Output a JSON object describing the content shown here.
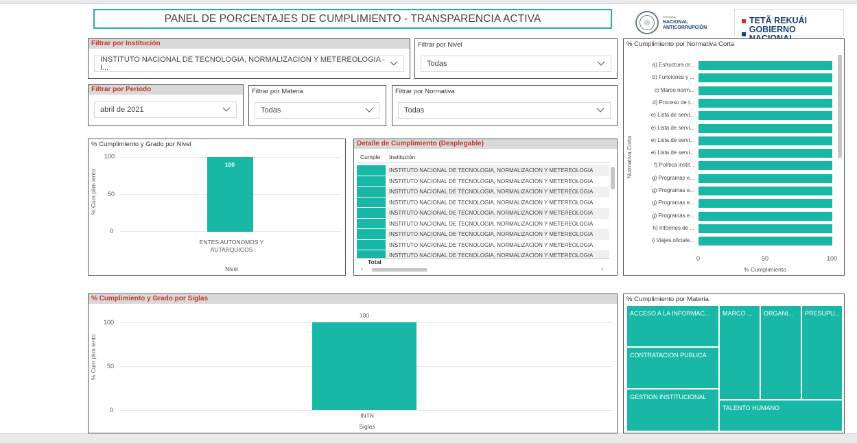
{
  "header": {
    "title": "PANEL DE PORCENTAJES DE CUMPLIMIENTO - TRANSPARENCIA ACTIVA",
    "logo_secretaria_small": "Secretaría",
    "logo_secretaria_line1": "NACIONAL",
    "logo_secretaria_line2": "ANTICORRUPCIÓN",
    "logo_gobierno_line1": "TETÃ REKUÁI",
    "logo_gobierno_line2": "GOBIERNO NACIONAL"
  },
  "filters": {
    "institucion": {
      "label": "Filtrar por Institución",
      "value": "INSTITUTO NACIONAL DE TECNOLOGIA, NORMALIZACION Y METEREOLOGIA - I..."
    },
    "nivel": {
      "label": "Filtrar por Nivel",
      "value": "Todas"
    },
    "periodo": {
      "label": "Filtrar por Periodo",
      "value": "abril de 2021"
    },
    "materia": {
      "label": "Filtrar por Materia",
      "value": "Todas"
    },
    "normativa": {
      "label": "Filtrar por Normativa",
      "value": "Todas"
    }
  },
  "chart_nivel": {
    "title": "% Cumplimiento y Grado por Nivel",
    "ylabel": "% Cum plim iento",
    "xlabel": "Nivel",
    "yticks": [
      "100",
      "50",
      "0"
    ],
    "data_label": "100"
  },
  "table": {
    "title": "Detalle de Cumplimiento (Desplegable)",
    "col1": "Cumple",
    "col2": "Institución",
    "row_text": "INSTITUTO NACIONAL DE TECNOLOGIA, NORMALIZACION Y METEREOLOGIA",
    "total_label": "Total"
  },
  "chart_normativa": {
    "title": "% Cumplimiento por Normativa Corta",
    "ylabel": "Normativa Corta",
    "xlabel": "% Cumplimiento",
    "xticks": [
      "0",
      "50",
      "100"
    ]
  },
  "chart_siglas": {
    "title": "% Cumplimiento y Grado por Siglas",
    "ylabel": "% Cum plim iento",
    "xlabel": "Siglas",
    "yticks": [
      "100",
      "50",
      "0"
    ],
    "data_label": "100"
  },
  "treemap": {
    "title": "% Cumplimiento por Materia",
    "cells": [
      "ACCESO A LA INFORMAC...",
      "MARCO ...",
      "ORGANI...",
      "PRESUPU...",
      "CONTRATACION PUBLICA",
      "GESTION INSTITUCIONAL",
      "TALENTO HUMANO"
    ]
  },
  "chart_data": [
    {
      "type": "bar",
      "title": "% Cumplimiento y Grado por Nivel",
      "xlabel": "Nivel",
      "ylabel": "% Cumplimiento",
      "categories": [
        "ENTES AUTONOMOS Y AUTARQUICOS"
      ],
      "values": [
        100
      ],
      "ylim": [
        0,
        100
      ]
    },
    {
      "type": "bar",
      "orientation": "horizontal",
      "title": "% Cumplimiento por Normativa Corta",
      "xlabel": "% Cumplimiento",
      "ylabel": "Normativa Corta",
      "categories": [
        "a) Estructura or...",
        "b) Funciones y ...",
        "c) Marco norm...",
        "d) Proceso de t...",
        "e) Lista de servi...",
        "e) Lista de servi...",
        "e) Lista de servi...",
        "e) Lista de servi...",
        "f) Política instit...",
        "g) Programas e...",
        "g) Programas e...",
        "g) Programas e...",
        "g) Programas e...",
        "h) Informes de ...",
        "i) Viajes oficiale..."
      ],
      "values": [
        100,
        100,
        100,
        100,
        100,
        100,
        100,
        100,
        100,
        100,
        100,
        100,
        100,
        100,
        100
      ],
      "xlim": [
        0,
        100
      ]
    },
    {
      "type": "bar",
      "title": "% Cumplimiento y Grado por Siglas",
      "xlabel": "Siglas",
      "ylabel": "% Cumplimiento",
      "categories": [
        "INTN"
      ],
      "values": [
        100
      ],
      "ylim": [
        0,
        100
      ]
    }
  ]
}
